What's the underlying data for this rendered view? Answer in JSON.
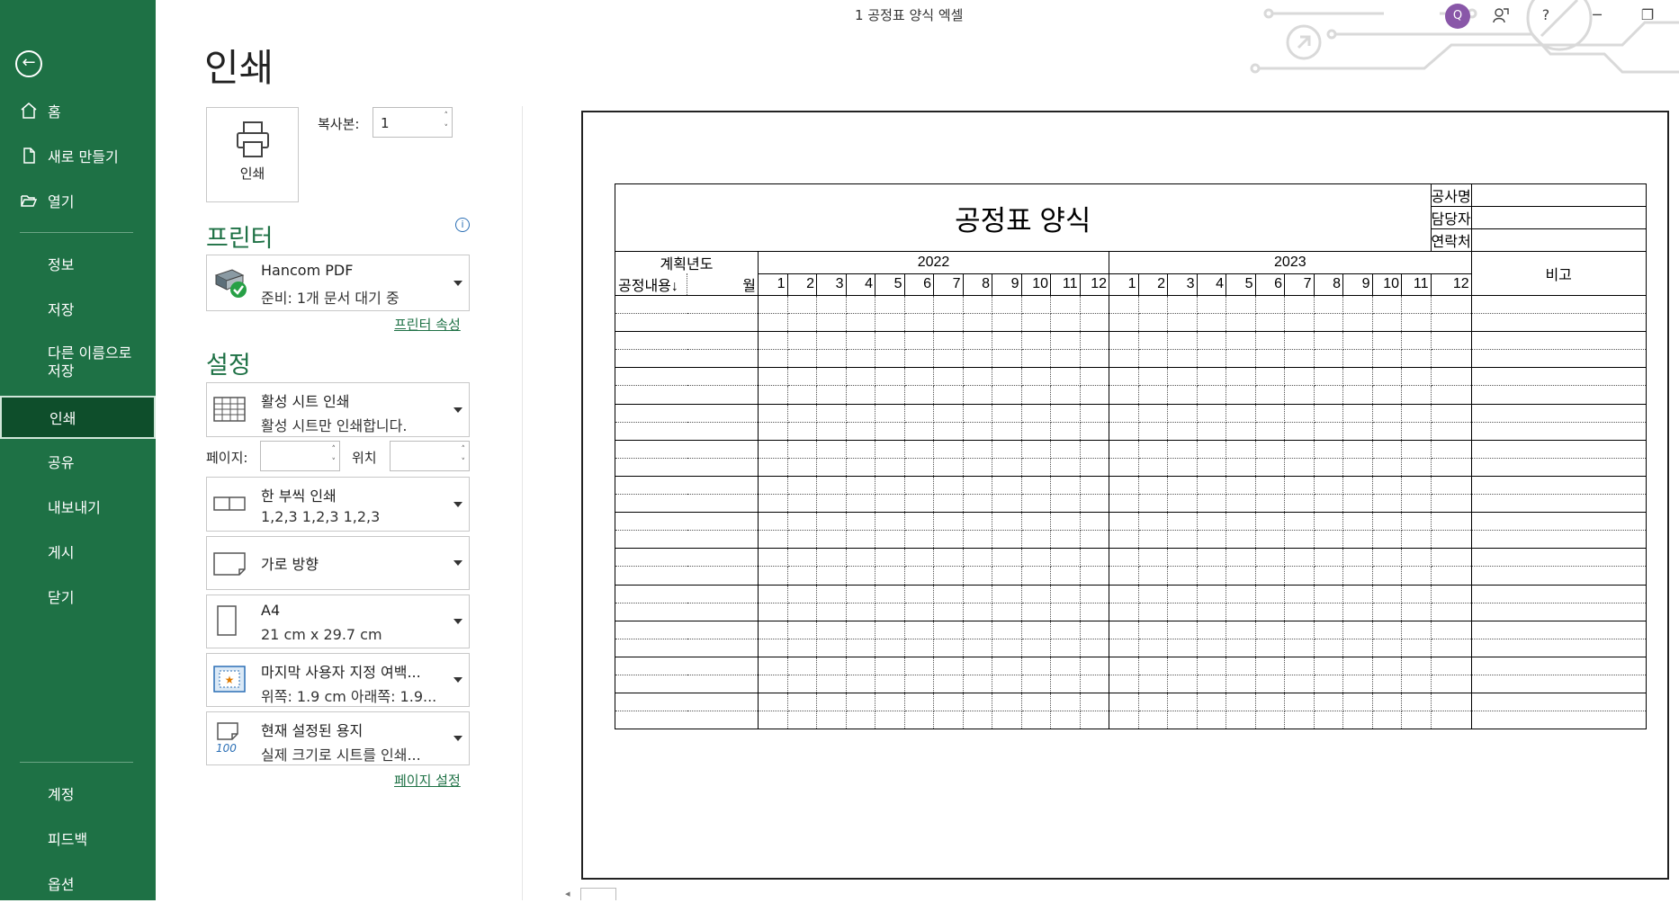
{
  "window": {
    "title": "1 공정표 양식 엑셀",
    "user_initial": "Q",
    "help": "?"
  },
  "sidebar": {
    "items": [
      {
        "label": "홈"
      },
      {
        "label": "새로 만들기"
      },
      {
        "label": "열기"
      },
      {
        "label": "정보"
      },
      {
        "label": "저장"
      },
      {
        "label": "다른 이름으로 저장",
        "line1": "다른 이름으로",
        "line2": "저장"
      },
      {
        "label": "인쇄",
        "active": true
      },
      {
        "label": "공유"
      },
      {
        "label": "내보내기"
      },
      {
        "label": "게시"
      },
      {
        "label": "닫기"
      },
      {
        "label": "계정"
      },
      {
        "label": "피드백"
      },
      {
        "label": "옵션"
      }
    ]
  },
  "print": {
    "heading": "인쇄",
    "print_button": "인쇄",
    "copies_label": "복사본:",
    "copies_value": "1"
  },
  "printer": {
    "heading": "프린터",
    "name": "Hancom PDF",
    "status": "준비: 1개 문서 대기 중",
    "properties_link": "프린터 속성"
  },
  "settings": {
    "heading": "설정",
    "scope": {
      "title": "활성 시트 인쇄",
      "desc": "활성 시트만 인쇄합니다."
    },
    "pages_label": "페이지:",
    "pages_value": "",
    "to_label": "위치",
    "to_value": "",
    "collate": {
      "title": "한 부씩 인쇄",
      "desc": "1,2,3    1,2,3    1,2,3"
    },
    "orientation": {
      "title": "가로 방향"
    },
    "paper": {
      "title": "A4",
      "desc": "21 cm x 29.7 cm"
    },
    "margins": {
      "title": "마지막 사용자 지정 여백...",
      "desc": "위쪽: 1.9 cm 아래쪽: 1.9..."
    },
    "scaling": {
      "title": "현재 설정된 용지",
      "desc": "실제 크기로 시트를 인쇄...",
      "icon_text": "100"
    },
    "page_setup_link": "페이지 설정"
  },
  "sheet": {
    "title": "공정표 양식",
    "info_labels": [
      "공사명",
      "담당자",
      "연락처"
    ],
    "plan_year_label": "계획년도",
    "work_label": "공정내용↓",
    "month_label": "월",
    "years": [
      "2022",
      "2023"
    ],
    "months": [
      "1",
      "2",
      "3",
      "4",
      "5",
      "6",
      "7",
      "8",
      "9",
      "10",
      "11",
      "12"
    ],
    "remarks_label": "비고"
  },
  "colors": {
    "sidebar": "#1e7145",
    "sidebar_active": "#0e4e2b",
    "accent": "#1e7145",
    "avatar": "#8957a8"
  }
}
